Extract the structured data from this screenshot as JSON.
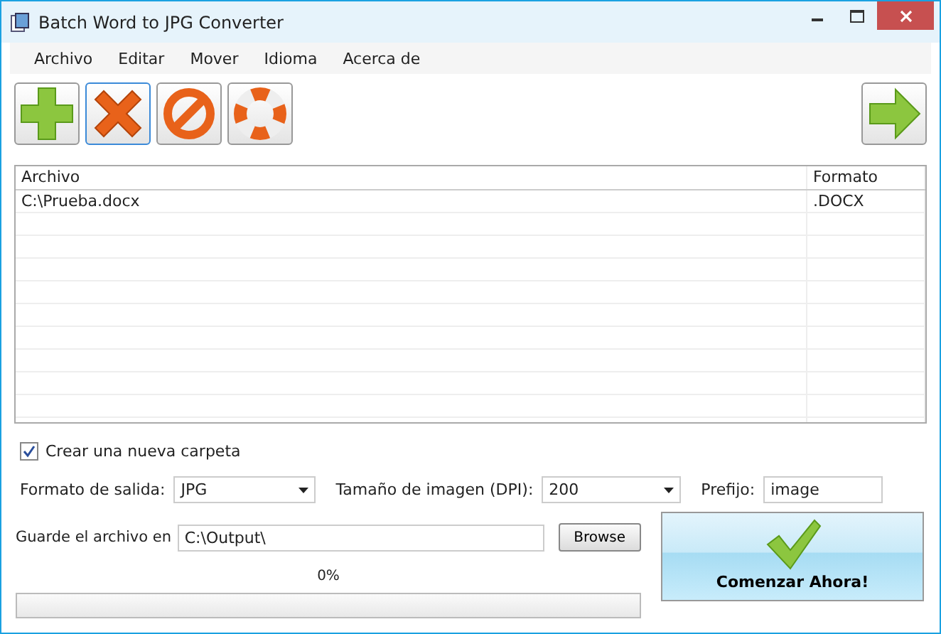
{
  "window": {
    "title": "Batch Word to JPG Converter"
  },
  "menu": [
    "Archivo",
    "Editar",
    "Mover",
    "Idioma",
    "Acerca de"
  ],
  "table": {
    "columns": [
      "Archivo",
      "Formato"
    ],
    "rows": [
      {
        "cells": [
          "C:\\Prueba.docx",
          ".DOCX"
        ]
      }
    ]
  },
  "options": {
    "new_folder": {
      "label": "Crear una nueva carpeta",
      "checked": true
    },
    "format": {
      "label": "Formato de salida:",
      "value": "JPG"
    },
    "dpi": {
      "label": "Tamaño de imagen (DPI):",
      "value": "200"
    },
    "prefix": {
      "label": "Prefijo:",
      "value": "image"
    },
    "output": {
      "label": "Guarde el archivo en",
      "value": "C:\\Output\\"
    },
    "browse": "Browse"
  },
  "progress": {
    "reading": "0%",
    "level": 0
  },
  "start_button": "Comenzar Ahora!"
}
